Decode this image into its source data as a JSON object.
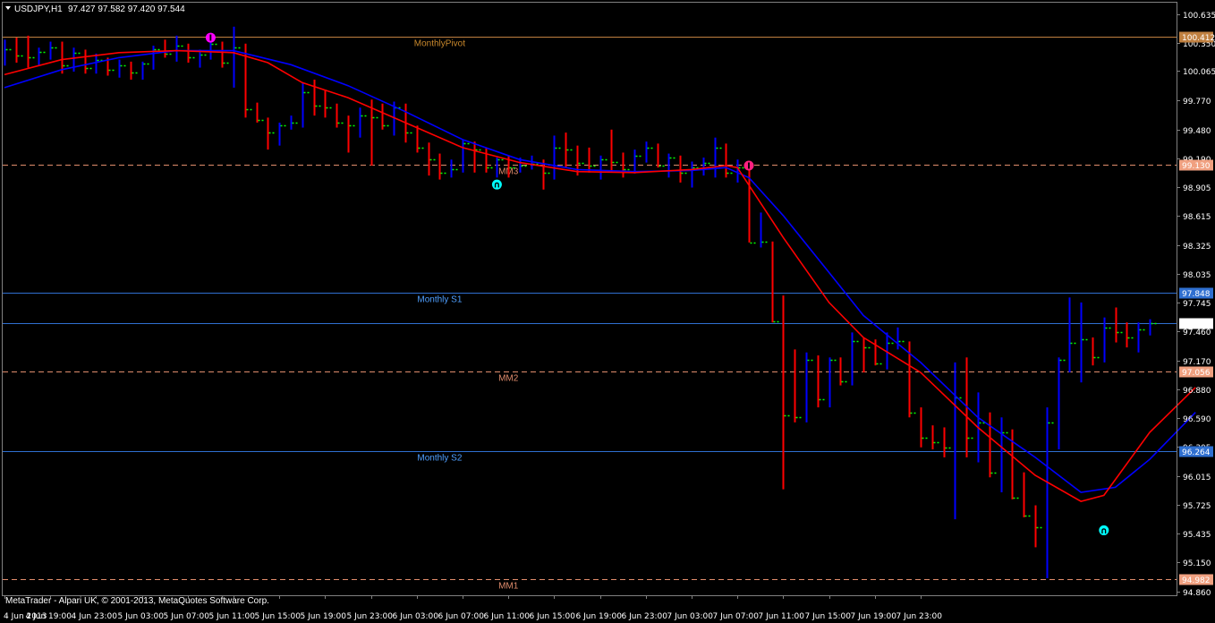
{
  "header": {
    "symbol": "USDJPY,H1",
    "ohlc": "97.427 97.582 97.420 97.544"
  },
  "footer": {
    "copyright": "MetaTrader - Alpari UK, © 2001-2013, MetaQuotes Software Corp."
  },
  "colors": {
    "background": "#000000",
    "bull": "#0000ff",
    "bear": "#ff0000",
    "close_tick": "#00ff00",
    "ma_fast": "#ff0000",
    "ma_slow": "#0000ff",
    "pivot": "#c08040",
    "support": "#2f6fd0",
    "murrey": "#e08c6c",
    "axis_text": "#ffffff",
    "frame": "#808080"
  },
  "chart_data": {
    "type": "candlestick",
    "ylim": [
      94.82,
      100.75
    ],
    "y_ticks": [
      "100.635",
      "100.350",
      "100.065",
      "99.770",
      "99.480",
      "99.190",
      "98.905",
      "98.615",
      "98.325",
      "98.035",
      "97.745",
      "97.460",
      "97.170",
      "96.880",
      "96.590",
      "96.305",
      "96.015",
      "95.725",
      "95.435",
      "95.150",
      "94.860"
    ],
    "x_ticks": [
      "4 Jun 2013",
      "4 Jun 19:00",
      "4 Jun 23:00",
      "5 Jun 03:00",
      "5 Jun 07:00",
      "5 Jun 11:00",
      "5 Jun 15:00",
      "5 Jun 19:00",
      "5 Jun 23:00",
      "6 Jun 03:00",
      "6 Jun 07:00",
      "6 Jun 11:00",
      "6 Jun 15:00",
      "6 Jun 19:00",
      "6 Jun 23:00",
      "7 Jun 03:00",
      "7 Jun 07:00",
      "7 Jun 11:00",
      "7 Jun 15:00",
      "7 Jun 19:00",
      "7 Jun 23:00"
    ],
    "x_tick_bars": [
      0,
      4,
      8,
      12,
      16,
      20,
      24,
      28,
      32,
      36,
      40,
      44,
      48,
      52,
      56,
      60,
      64,
      68,
      72,
      76,
      80
    ],
    "levels": [
      {
        "name": "MonthlyPivot",
        "value": 100.412,
        "label": "100.412",
        "kind": "pivot",
        "style": "solid",
        "text_bar": 38
      },
      {
        "name": "MM3",
        "value": 99.13,
        "label": "99.130",
        "kind": "murrey",
        "style": "dash",
        "text_bar": 44
      },
      {
        "name": "Monthly S1",
        "value": 97.848,
        "label": "97.848",
        "kind": "support",
        "style": "solid",
        "text_bar": 38
      },
      {
        "name": "",
        "value": 97.544,
        "label": "97.544",
        "kind": "current",
        "style": "solid",
        "text_bar": 0
      },
      {
        "name": "MM2",
        "value": 97.056,
        "label": "97.056",
        "kind": "murrey",
        "style": "dash",
        "text_bar": 44
      },
      {
        "name": "Monthly S2",
        "value": 96.264,
        "label": "96.264",
        "kind": "support",
        "style": "solid",
        "text_bar": 38
      },
      {
        "name": "MM1",
        "value": 94.982,
        "label": "94.982",
        "kind": "murrey",
        "style": "dash",
        "text_bar": 44
      }
    ],
    "bars": [
      [
        100.2,
        100.38,
        100.12,
        100.28
      ],
      [
        100.28,
        100.4,
        100.15,
        100.22
      ],
      [
        100.22,
        100.42,
        100.1,
        100.2
      ],
      [
        100.2,
        100.3,
        100.12,
        100.26
      ],
      [
        100.26,
        100.36,
        100.18,
        100.3
      ],
      [
        100.3,
        100.36,
        100.04,
        100.12
      ],
      [
        100.12,
        100.3,
        100.06,
        100.25
      ],
      [
        100.25,
        100.28,
        100.04,
        100.1
      ],
      [
        100.1,
        100.24,
        100.04,
        100.18
      ],
      [
        100.18,
        100.2,
        100.02,
        100.08
      ],
      [
        100.08,
        100.18,
        100.0,
        100.12
      ],
      [
        100.12,
        100.16,
        99.98,
        100.05
      ],
      [
        100.05,
        100.16,
        99.98,
        100.14
      ],
      [
        100.14,
        100.32,
        100.08,
        100.28
      ],
      [
        100.28,
        100.38,
        100.2,
        100.24
      ],
      [
        100.24,
        100.42,
        100.16,
        100.32
      ],
      [
        100.32,
        100.34,
        100.15,
        100.2
      ],
      [
        100.2,
        100.28,
        100.1,
        100.23
      ],
      [
        100.23,
        100.42,
        100.18,
        100.34
      ],
      [
        100.34,
        100.36,
        100.1,
        100.15
      ],
      [
        100.15,
        100.51,
        99.9,
        100.3
      ],
      [
        100.3,
        100.34,
        99.6,
        99.68
      ],
      [
        99.68,
        99.75,
        99.55,
        99.58
      ],
      [
        99.58,
        99.6,
        99.28,
        99.45
      ],
      [
        99.45,
        99.55,
        99.32,
        99.52
      ],
      [
        99.52,
        99.62,
        99.48,
        99.55
      ],
      [
        99.55,
        99.95,
        99.5,
        99.85
      ],
      [
        99.85,
        99.98,
        99.62,
        99.72
      ],
      [
        99.72,
        99.88,
        99.6,
        99.7
      ],
      [
        99.7,
        99.74,
        99.5,
        99.55
      ],
      [
        99.55,
        99.62,
        99.25,
        99.52
      ],
      [
        99.52,
        99.7,
        99.4,
        99.62
      ],
      [
        99.62,
        99.78,
        99.12,
        99.6
      ],
      [
        99.6,
        99.74,
        99.48,
        99.52
      ],
      [
        99.52,
        99.76,
        99.42,
        99.7
      ],
      [
        99.7,
        99.74,
        99.35,
        99.45
      ],
      [
        99.45,
        99.52,
        99.25,
        99.3
      ],
      [
        99.3,
        99.35,
        99.02,
        99.18
      ],
      [
        99.18,
        99.24,
        98.98,
        99.05
      ],
      [
        99.05,
        99.18,
        99.0,
        99.08
      ],
      [
        99.08,
        99.38,
        99.05,
        99.34
      ],
      [
        99.34,
        99.36,
        99.05,
        99.28
      ],
      [
        99.28,
        99.3,
        99.05,
        99.1
      ],
      [
        99.1,
        99.2,
        99.0,
        99.18
      ],
      [
        99.18,
        99.22,
        99.0,
        99.1
      ],
      [
        99.1,
        99.2,
        99.05,
        99.12
      ],
      [
        99.12,
        99.22,
        99.08,
        99.14
      ],
      [
        99.14,
        99.18,
        98.88,
        99.05
      ],
      [
        99.05,
        99.42,
        98.98,
        99.3
      ],
      [
        99.3,
        99.45,
        99.1,
        99.28
      ],
      [
        99.28,
        99.32,
        99.02,
        99.15
      ],
      [
        99.15,
        99.3,
        99.05,
        99.12
      ],
      [
        99.12,
        99.22,
        98.98,
        99.18
      ],
      [
        99.18,
        99.48,
        99.05,
        99.16
      ],
      [
        99.16,
        99.25,
        99.0,
        99.08
      ],
      [
        99.08,
        99.28,
        99.04,
        99.22
      ],
      [
        99.22,
        99.36,
        99.15,
        99.3
      ],
      [
        99.3,
        99.34,
        99.1,
        99.12
      ],
      [
        99.12,
        99.24,
        99.0,
        99.2
      ],
      [
        99.2,
        99.22,
        98.95,
        99.05
      ],
      [
        99.05,
        99.16,
        98.9,
        99.1
      ],
      [
        99.1,
        99.2,
        99.02,
        99.15
      ],
      [
        99.15,
        99.4,
        99.0,
        99.3
      ],
      [
        99.3,
        99.34,
        99.0,
        99.05
      ],
      [
        99.05,
        99.18,
        98.95,
        99.1
      ],
      [
        99.1,
        99.15,
        98.35,
        98.35
      ],
      [
        98.35,
        98.65,
        98.3,
        98.36
      ],
      [
        98.36,
        98.36,
        97.55,
        97.56
      ],
      [
        97.56,
        97.82,
        95.88,
        96.62
      ],
      [
        96.62,
        97.28,
        96.55,
        96.6
      ],
      [
        96.6,
        97.25,
        96.55,
        97.18
      ],
      [
        97.18,
        97.22,
        96.7,
        96.78
      ],
      [
        96.78,
        97.2,
        96.7,
        97.18
      ],
      [
        97.18,
        97.2,
        96.92,
        96.96
      ],
      [
        96.96,
        97.45,
        96.92,
        97.36
      ],
      [
        97.36,
        97.4,
        97.05,
        97.3
      ],
      [
        97.3,
        97.38,
        97.12,
        97.14
      ],
      [
        97.14,
        97.45,
        97.08,
        97.35
      ],
      [
        97.35,
        97.5,
        97.28,
        97.36
      ],
      [
        97.36,
        97.36,
        96.6,
        96.65
      ],
      [
        96.65,
        96.7,
        96.3,
        96.4
      ],
      [
        96.4,
        96.52,
        96.28,
        96.35
      ],
      [
        96.35,
        96.5,
        96.2,
        96.3
      ],
      [
        96.3,
        97.15,
        95.58,
        96.8
      ],
      [
        96.8,
        97.2,
        96.2,
        96.4
      ],
      [
        96.4,
        96.85,
        96.15,
        96.55
      ],
      [
        96.55,
        96.65,
        96.0,
        96.05
      ],
      [
        96.05,
        96.6,
        95.85,
        96.45
      ],
      [
        96.45,
        96.48,
        95.78,
        95.8
      ],
      [
        95.8,
        96.05,
        95.6,
        95.62
      ],
      [
        95.62,
        95.72,
        95.3,
        95.5
      ],
      [
        95.5,
        96.7,
        94.99,
        96.55
      ],
      [
        96.55,
        97.2,
        96.28,
        97.18
      ],
      [
        97.18,
        97.8,
        97.05,
        97.35
      ],
      [
        97.35,
        97.75,
        96.95,
        97.38
      ],
      [
        97.38,
        97.4,
        97.12,
        97.2
      ],
      [
        97.2,
        97.6,
        97.15,
        97.5
      ],
      [
        97.5,
        97.7,
        97.35,
        97.45
      ],
      [
        97.45,
        97.55,
        97.3,
        97.4
      ],
      [
        97.4,
        97.55,
        97.25,
        97.48
      ],
      [
        97.427,
        97.582,
        97.42,
        97.544
      ]
    ],
    "ma_fast": [
      [
        0,
        100.03
      ],
      [
        5,
        100.18
      ],
      [
        10,
        100.25
      ],
      [
        15,
        100.27
      ],
      [
        20,
        100.25
      ],
      [
        23,
        100.15
      ],
      [
        26,
        99.95
      ],
      [
        30,
        99.8
      ],
      [
        35,
        99.55
      ],
      [
        40,
        99.3
      ],
      [
        45,
        99.15
      ],
      [
        50,
        99.06
      ],
      [
        55,
        99.05
      ],
      [
        60,
        99.08
      ],
      [
        63,
        99.12
      ],
      [
        64,
        99.1
      ],
      [
        66,
        98.75
      ],
      [
        68,
        98.4
      ],
      [
        72,
        97.75
      ],
      [
        75,
        97.4
      ],
      [
        80,
        97.05
      ],
      [
        85,
        96.5
      ],
      [
        90,
        96.02
      ],
      [
        94,
        95.76
      ],
      [
        96,
        95.82
      ],
      [
        100,
        96.45
      ],
      [
        104,
        96.9
      ]
    ],
    "ma_slow": [
      [
        0,
        99.9
      ],
      [
        5,
        100.08
      ],
      [
        10,
        100.2
      ],
      [
        15,
        100.27
      ],
      [
        20,
        100.27
      ],
      [
        25,
        100.13
      ],
      [
        30,
        99.92
      ],
      [
        35,
        99.66
      ],
      [
        40,
        99.38
      ],
      [
        45,
        99.18
      ],
      [
        50,
        99.08
      ],
      [
        55,
        99.06
      ],
      [
        60,
        99.07
      ],
      [
        63,
        99.1
      ],
      [
        65,
        99.0
      ],
      [
        68,
        98.62
      ],
      [
        72,
        98.05
      ],
      [
        75,
        97.62
      ],
      [
        80,
        97.15
      ],
      [
        85,
        96.6
      ],
      [
        90,
        96.2
      ],
      [
        94,
        95.85
      ],
      [
        97,
        95.9
      ],
      [
        100,
        96.18
      ],
      [
        104,
        96.65
      ]
    ],
    "markers": [
      {
        "bar": 18,
        "y": 100.4,
        "color": "#ff00ff",
        "glyph": "I"
      },
      {
        "bar": 43,
        "y": 98.93,
        "color": "#00ffff",
        "glyph": "∩"
      },
      {
        "bar": 65,
        "y": 99.12,
        "color": "#ff2080",
        "glyph": "I"
      },
      {
        "bar": 96,
        "y": 95.47,
        "color": "#00ffff",
        "glyph": "∩"
      }
    ]
  }
}
